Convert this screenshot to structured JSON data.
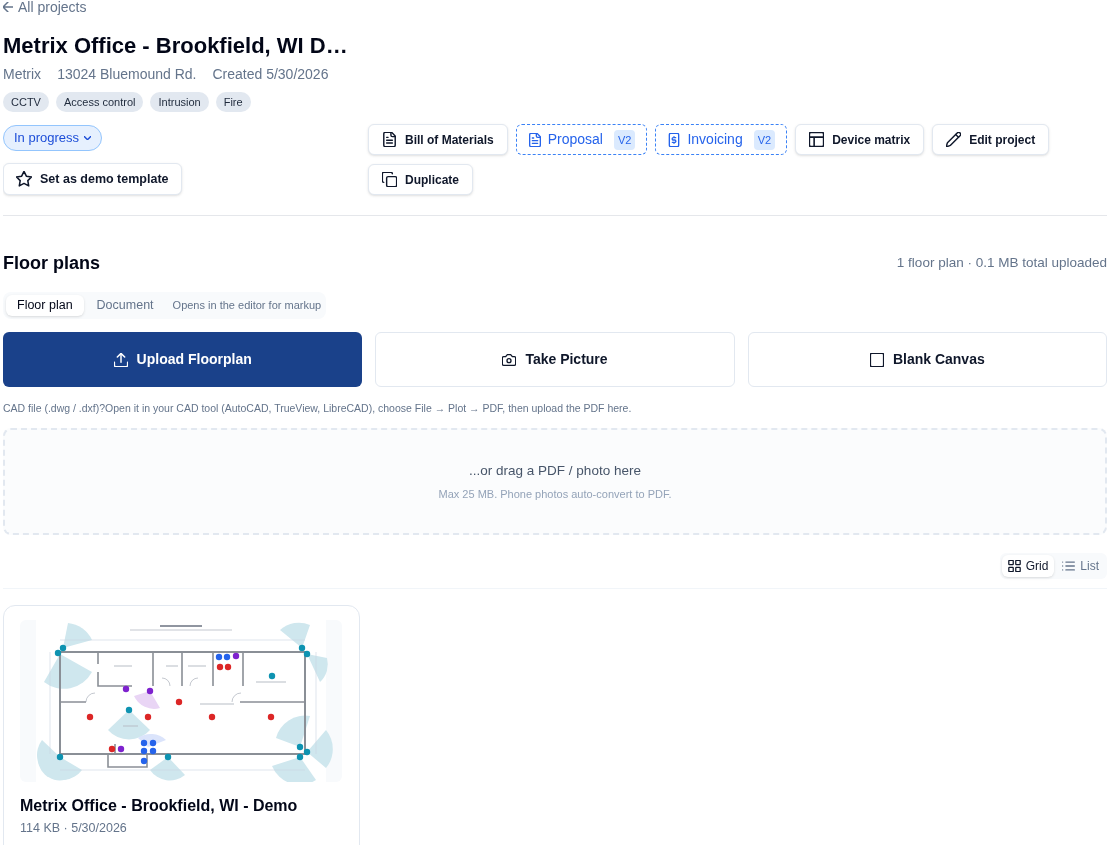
{
  "back_link": {
    "label": "All projects"
  },
  "project": {
    "title": "Metrix Office - Brookfield, WI D…",
    "meta": [
      "Metrix",
      "13024 Bluemound Rd.",
      "Created 5/30/2026"
    ],
    "tags": [
      "CCTV",
      "Access control",
      "Intrusion",
      "Fire"
    ]
  },
  "status": {
    "label": "In progress"
  },
  "template_button": {
    "label": "Set as demo template"
  },
  "actions": [
    {
      "label": "Bill of Materials",
      "kind": "plain"
    },
    {
      "label": "Proposal",
      "kind": "versioned",
      "badge": "V2"
    },
    {
      "label": "Invoicing",
      "kind": "versioned",
      "badge": "V2"
    },
    {
      "label": "Device matrix",
      "kind": "plain"
    },
    {
      "label": "Edit project",
      "kind": "plain"
    },
    {
      "label": "Duplicate",
      "kind": "plain"
    }
  ],
  "floor_plans": {
    "heading": "Floor plans",
    "summary": "1 floor plan · 0.1 MB total uploaded",
    "tabs": [
      {
        "label": "Floor plan",
        "selected": true
      },
      {
        "label": "Document",
        "selected": false
      }
    ],
    "tab_hint": "Opens in the editor for markup",
    "upload_options": [
      {
        "label": "Upload Floorplan",
        "kind": "primary"
      },
      {
        "label": "Take Picture",
        "kind": "secondary"
      },
      {
        "label": "Blank Canvas",
        "kind": "secondary"
      }
    ],
    "cad_hint": "CAD file (.dwg / .dxf)?Open it in your CAD tool (AutoCAD, TrueView, LibreCAD), choose File → Plot → PDF, then upload the PDF here.",
    "dropzone": {
      "title": "...or drag a PDF / photo here",
      "subtitle": "Max 25 MB. Phone photos auto-convert to PDF."
    },
    "view_toggle": [
      {
        "label": "Grid",
        "selected": true
      },
      {
        "label": "List",
        "selected": false
      }
    ],
    "plans": [
      {
        "title": "Metrix Office - Brookfield, WI - Demo",
        "details": "114 KB · 5/30/2026"
      }
    ]
  }
}
